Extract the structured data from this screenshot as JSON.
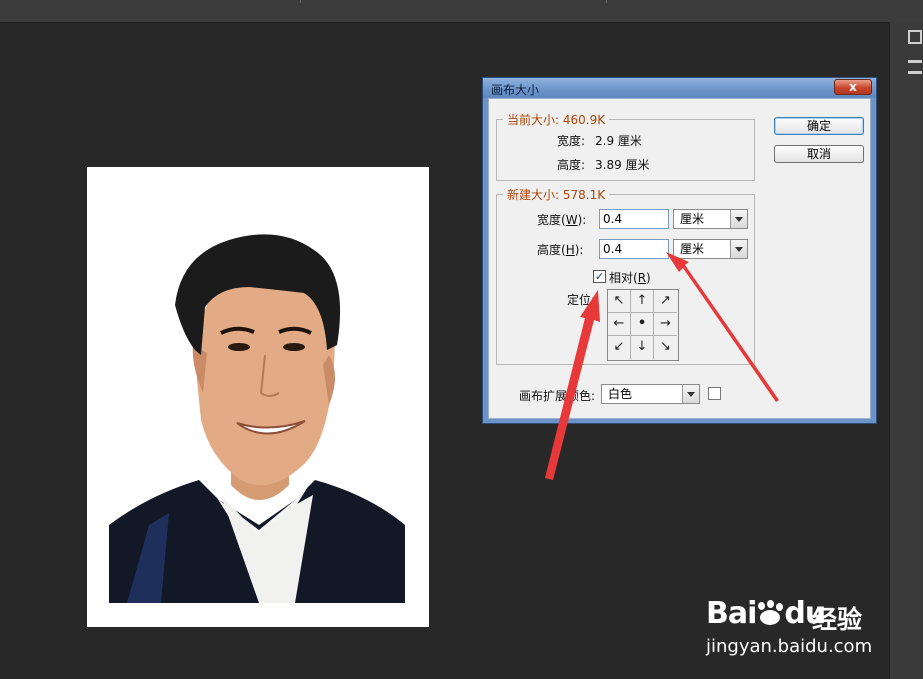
{
  "dialog": {
    "title": "画布大小",
    "close_label": "x",
    "ok_label": "确定",
    "cancel_label": "取消",
    "current": {
      "legend": "当前大小: 460.9K",
      "width_label": "宽度:",
      "width_value": "2.9 厘米",
      "height_label": "高度:",
      "height_value": "3.89 厘米"
    },
    "new": {
      "legend": "新建大小: 578.1K",
      "width_label_pre": "宽度(",
      "width_key": "W",
      "width_label_post": "):",
      "width_value": "0.4",
      "width_unit": "厘米",
      "height_label_pre": "高度(",
      "height_key": "H",
      "height_label_post": "):",
      "height_value": "0.4",
      "height_unit": "厘米",
      "relative_label_pre": "相对(",
      "relative_key": "R",
      "relative_label_post": ")",
      "relative_checked": true,
      "anchor_label": "定位:",
      "anchor_glyphs": [
        "↖",
        "↑",
        "↗",
        "←",
        "•",
        "→",
        "↙",
        "↓",
        "↘"
      ]
    },
    "extension_color_label": "画布扩展颜色:",
    "extension_color_value": "白色",
    "extension_swatch_color": "#ffffff"
  },
  "annotation_color": "#e8393a",
  "watermark": {
    "brand": "Bai",
    "brand_mid": "du",
    "cn": "经验",
    "site": "jingyan.baidu.com"
  }
}
